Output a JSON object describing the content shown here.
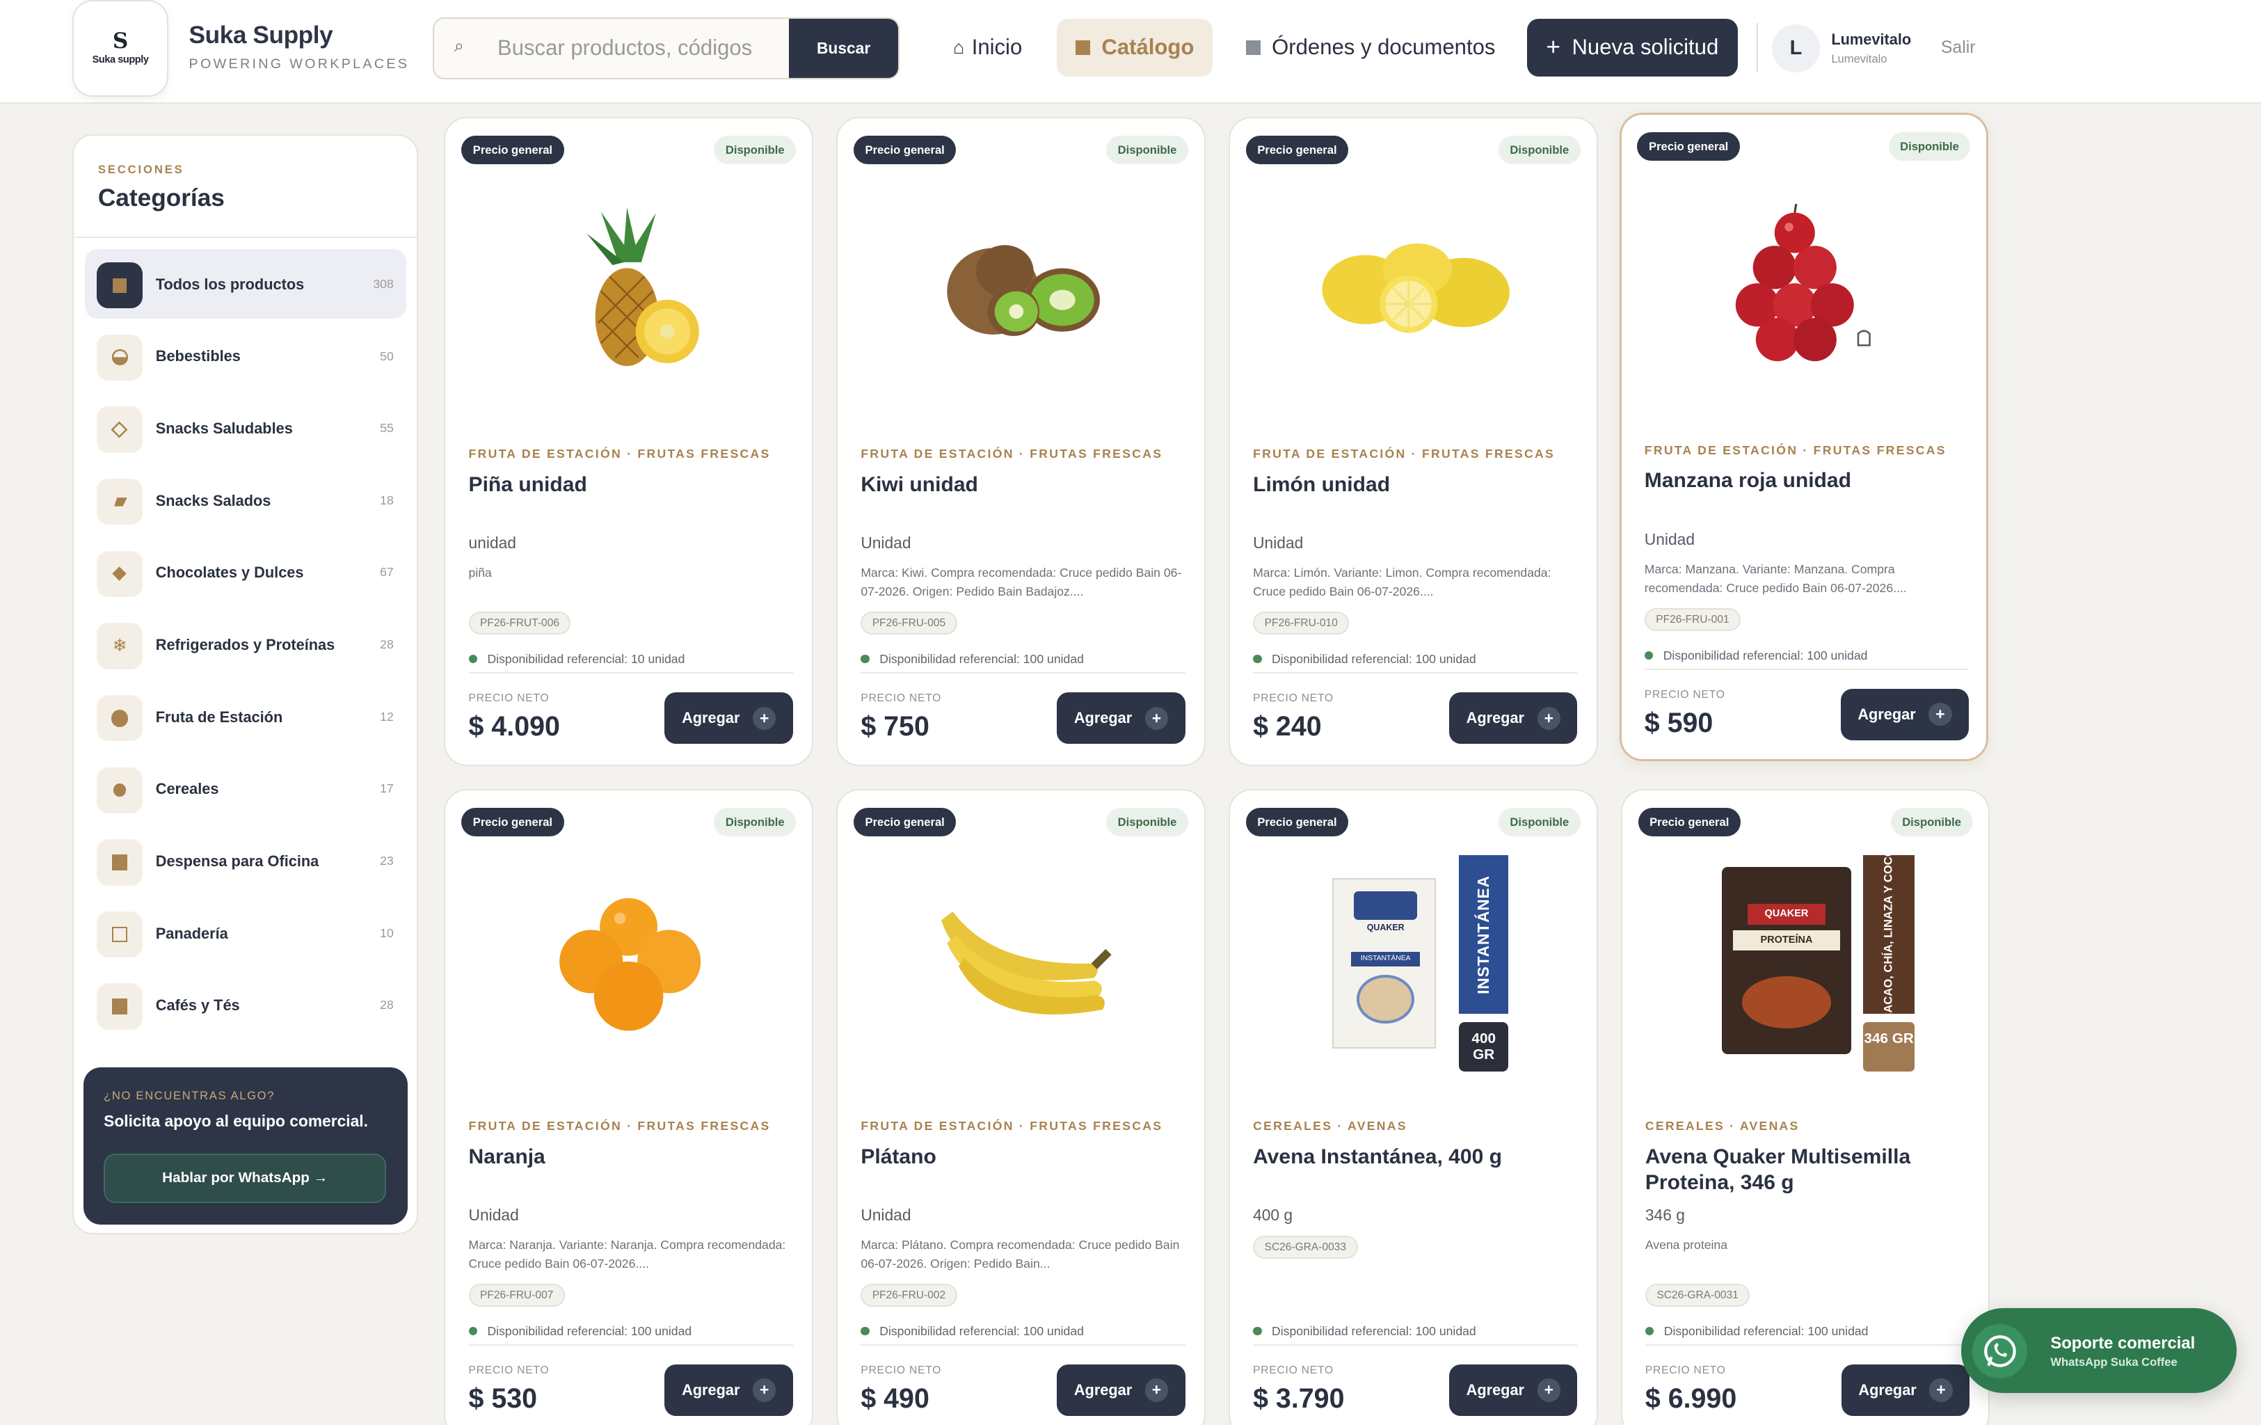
{
  "brand": {
    "logo_mark": "S",
    "logo_text": "Suka supply",
    "name": "Suka Supply",
    "tagline": "POWERING WORKPLACES"
  },
  "search": {
    "placeholder": "Buscar productos, códigos",
    "button": "Buscar"
  },
  "nav": {
    "inicio": "Inicio",
    "catalogo": "Catálogo",
    "ordenes": "Órdenes y documentos",
    "nueva": "Nueva solicitud"
  },
  "user": {
    "initial": "L",
    "name": "Lumevitalo",
    "sub": "Lumevitalo",
    "logout": "Salir"
  },
  "sidebar": {
    "eyebrow": "SECCIONES",
    "title": "Categorías",
    "items": [
      {
        "label": "Todos los productos",
        "count": "308"
      },
      {
        "label": "Bebestibles",
        "count": "50"
      },
      {
        "label": "Snacks Saludables",
        "count": "55"
      },
      {
        "label": "Snacks Salados",
        "count": "18"
      },
      {
        "label": "Chocolates y Dulces",
        "count": "67"
      },
      {
        "label": "Refrigerados y Proteínas",
        "count": "28"
      },
      {
        "label": "Fruta de Estación",
        "count": "12"
      },
      {
        "label": "Cereales",
        "count": "17"
      },
      {
        "label": "Despensa para Oficina",
        "count": "23"
      },
      {
        "label": "Panadería",
        "count": "10"
      },
      {
        "label": "Cafés y Tés",
        "count": "28"
      }
    ],
    "help_question": "¿NO ENCUENTRAS ALGO?",
    "help_text": "Solicita apoyo al equipo comercial.",
    "help_button": "Hablar por WhatsApp →"
  },
  "card_common": {
    "price_badge": "Precio general",
    "stock_badge": "Disponible",
    "price_label": "PRECIO NETO",
    "add_label": "Agregar"
  },
  "products": [
    {
      "category": "FRUTA DE ESTACIÓN · FRUTAS FRESCAS",
      "name": "Piña unidad",
      "unit": "unidad",
      "desc": "piña",
      "sku": "PF26-FRUT-006",
      "avail": "Disponibilidad referencial: 10 unidad",
      "price": "$ 4.090"
    },
    {
      "category": "FRUTA DE ESTACIÓN · FRUTAS FRESCAS",
      "name": "Kiwi unidad",
      "unit": "Unidad",
      "desc": "Marca: Kiwi. Compra recomendada: Cruce pedido Bain 06-07-2026. Origen: Pedido Bain Badajoz....",
      "sku": "PF26-FRU-005",
      "avail": "Disponibilidad referencial: 100 unidad",
      "price": "$ 750"
    },
    {
      "category": "FRUTA DE ESTACIÓN · FRUTAS FRESCAS",
      "name": "Limón unidad",
      "unit": "Unidad",
      "desc": "Marca: Limón. Variante: Limon. Compra recomendada: Cruce pedido Bain 06-07-2026....",
      "sku": "PF26-FRU-010",
      "avail": "Disponibilidad referencial: 100 unidad",
      "price": "$ 240"
    },
    {
      "category": "FRUTA DE ESTACIÓN · FRUTAS FRESCAS",
      "name": "Manzana roja unidad",
      "unit": "Unidad",
      "desc": "Marca: Manzana. Variante: Manzana. Compra recomendada: Cruce pedido Bain 06-07-2026....",
      "sku": "PF26-FRU-001",
      "avail": "Disponibilidad referencial: 100 unidad",
      "price": "$ 590"
    },
    {
      "category": "FRUTA DE ESTACIÓN · FRUTAS FRESCAS",
      "name": "Naranja",
      "unit": "Unidad",
      "desc": "Marca: Naranja. Variante: Naranja. Compra recomendada: Cruce pedido Bain 06-07-2026....",
      "sku": "PF26-FRU-007",
      "avail": "Disponibilidad referencial: 100 unidad",
      "price": "$ 530"
    },
    {
      "category": "FRUTA DE ESTACIÓN · FRUTAS FRESCAS",
      "name": "Plátano",
      "unit": "Unidad",
      "desc": "Marca: Plátano. Compra recomendada: Cruce pedido Bain 06-07-2026. Origen: Pedido Bain...",
      "sku": "PF26-FRU-002",
      "avail": "Disponibilidad referencial: 100 unidad",
      "price": "$ 490"
    },
    {
      "category": "CEREALES · AVENAS",
      "name": "Avena Instantánea, 400 g",
      "unit": "400 g",
      "desc": "",
      "sku": "SC26-GRA-0033",
      "avail": "Disponibilidad referencial: 100 unidad",
      "price": "$ 3.790",
      "pack_side": "INSTANTÁNEA",
      "pack_weight": "400 GR",
      "pack_brand": "QUAKER",
      "pack_label": "INSTANTÁNEA"
    },
    {
      "category": "CEREALES · AVENAS",
      "name": "Avena Quaker Multisemilla Proteina, 346 g",
      "unit": "346 g",
      "desc": "Avena proteina",
      "sku": "SC26-GRA-0031",
      "avail": "Disponibilidad referencial: 100 unidad",
      "price": "$ 6.990",
      "pack_side": "CACAO, CHÍA, LINAZA Y COCO",
      "pack_weight": "346 GR",
      "pack_brand": "QUAKER",
      "pack_label": "PROTEÍNA"
    }
  ],
  "whatsapp": {
    "title": "Soporte comercial",
    "sub": "WhatsApp Suka Coffee"
  }
}
